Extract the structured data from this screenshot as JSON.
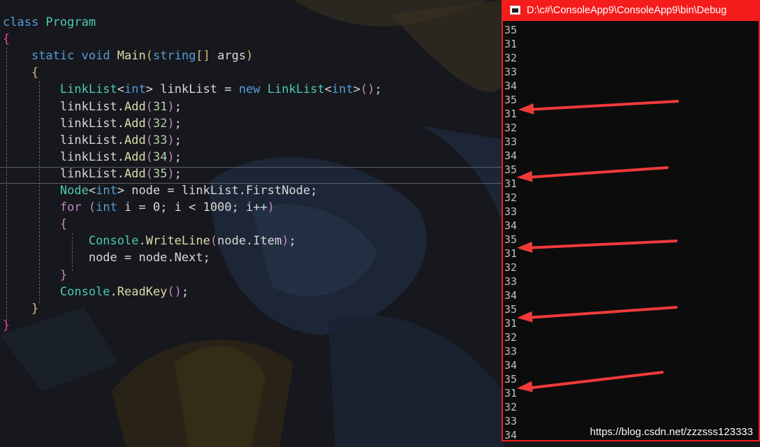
{
  "editor": {
    "lines": [
      [
        {
          "t": "class ",
          "c": "#569cd6"
        },
        {
          "t": "Program",
          "c": "#4ec9b0"
        }
      ],
      [
        {
          "t": "{",
          "c": "#e8489a"
        }
      ],
      [
        {
          "t": "    "
        },
        {
          "t": "static ",
          "c": "#569cd6"
        },
        {
          "t": "void ",
          "c": "#569cd6"
        },
        {
          "t": "Main",
          "c": "#dcdcaa"
        },
        {
          "t": "(",
          "c": "#d7ba7d"
        },
        {
          "t": "string",
          "c": "#569cd6"
        },
        {
          "t": "[]",
          "c": "#d7ba7d"
        },
        {
          "t": " args",
          "c": "#d8d8d8"
        },
        {
          "t": ")",
          "c": "#d7ba7d"
        }
      ],
      [
        {
          "t": "    "
        },
        {
          "t": "{",
          "c": "#d7ba7d"
        }
      ],
      [
        {
          "t": "        "
        },
        {
          "t": "LinkList",
          "c": "#4ec9b0"
        },
        {
          "t": "<",
          "c": "#d8d8d8"
        },
        {
          "t": "int",
          "c": "#569cd6"
        },
        {
          "t": "> linkList = ",
          "c": "#d8d8d8"
        },
        {
          "t": "new ",
          "c": "#569cd6"
        },
        {
          "t": "LinkList",
          "c": "#4ec9b0"
        },
        {
          "t": "<",
          "c": "#d8d8d8"
        },
        {
          "t": "int",
          "c": "#569cd6"
        },
        {
          "t": ">",
          "c": "#d8d8d8"
        },
        {
          "t": "()",
          "c": "#c586c0"
        },
        {
          "t": ";",
          "c": "#d8d8d8"
        }
      ],
      [
        {
          "t": "        "
        },
        {
          "t": "linkList.",
          "c": "#d8d8d8"
        },
        {
          "t": "Add",
          "c": "#dcdcaa"
        },
        {
          "t": "(",
          "c": "#c586c0"
        },
        {
          "t": "31",
          "c": "#b5cea8"
        },
        {
          "t": ")",
          "c": "#c586c0"
        },
        {
          "t": ";",
          "c": "#d8d8d8"
        }
      ],
      [
        {
          "t": "        "
        },
        {
          "t": "linkList.",
          "c": "#d8d8d8"
        },
        {
          "t": "Add",
          "c": "#dcdcaa"
        },
        {
          "t": "(",
          "c": "#c586c0"
        },
        {
          "t": "32",
          "c": "#b5cea8"
        },
        {
          "t": ")",
          "c": "#c586c0"
        },
        {
          "t": ";",
          "c": "#d8d8d8"
        }
      ],
      [
        {
          "t": "        "
        },
        {
          "t": "linkList.",
          "c": "#d8d8d8"
        },
        {
          "t": "Add",
          "c": "#dcdcaa"
        },
        {
          "t": "(",
          "c": "#c586c0"
        },
        {
          "t": "33",
          "c": "#b5cea8"
        },
        {
          "t": ")",
          "c": "#c586c0"
        },
        {
          "t": ";",
          "c": "#d8d8d8"
        }
      ],
      [
        {
          "t": "        "
        },
        {
          "t": "linkList.",
          "c": "#d8d8d8"
        },
        {
          "t": "Add",
          "c": "#dcdcaa"
        },
        {
          "t": "(",
          "c": "#c586c0"
        },
        {
          "t": "34",
          "c": "#b5cea8"
        },
        {
          "t": ")",
          "c": "#c586c0"
        },
        {
          "t": ";",
          "c": "#d8d8d8"
        }
      ],
      [
        {
          "t": "        "
        },
        {
          "t": "linkList.",
          "c": "#d8d8d8"
        },
        {
          "t": "Add",
          "c": "#dcdcaa"
        },
        {
          "t": "(",
          "c": "#c586c0"
        },
        {
          "t": "35",
          "c": "#b5cea8"
        },
        {
          "t": ")",
          "c": "#c586c0"
        },
        {
          "t": ";",
          "c": "#d8d8d8"
        }
      ],
      [
        {
          "t": "        "
        },
        {
          "t": "Node",
          "c": "#4ec9b0"
        },
        {
          "t": "<",
          "c": "#d8d8d8"
        },
        {
          "t": "int",
          "c": "#569cd6"
        },
        {
          "t": "> node = linkList.FirstNode;",
          "c": "#d8d8d8"
        }
      ],
      [
        {
          "t": "        "
        },
        {
          "t": "for ",
          "c": "#c586c0"
        },
        {
          "t": "(",
          "c": "#c586c0"
        },
        {
          "t": "int ",
          "c": "#569cd6"
        },
        {
          "t": "i = 0; i < 1000; i++",
          "c": "#d8d8d8"
        },
        {
          "t": ")",
          "c": "#c586c0"
        }
      ],
      [
        {
          "t": "        "
        },
        {
          "t": "{",
          "c": "#c586c0"
        }
      ],
      [
        {
          "t": "            "
        },
        {
          "t": "Console",
          "c": "#4ec9b0"
        },
        {
          "t": ".",
          "c": "#d8d8d8"
        },
        {
          "t": "WriteLine",
          "c": "#dcdcaa"
        },
        {
          "t": "(",
          "c": "#c586c0"
        },
        {
          "t": "node.Item",
          "c": "#d8d8d8"
        },
        {
          "t": ")",
          "c": "#c586c0"
        },
        {
          "t": ";",
          "c": "#d8d8d8"
        }
      ],
      [
        {
          "t": "            "
        },
        {
          "t": "node = node.Next;",
          "c": "#d8d8d8"
        }
      ],
      [
        {
          "t": "        "
        },
        {
          "t": "}",
          "c": "#c586c0"
        }
      ],
      [
        {
          "t": "        "
        },
        {
          "t": "Console",
          "c": "#4ec9b0"
        },
        {
          "t": ".",
          "c": "#d8d8d8"
        },
        {
          "t": "ReadKey",
          "c": "#dcdcaa"
        },
        {
          "t": "()",
          "c": "#c586c0"
        },
        {
          "t": ";",
          "c": "#d8d8d8"
        }
      ],
      [
        {
          "t": "    "
        },
        {
          "t": "}",
          "c": "#d7ba7d"
        }
      ],
      [
        {
          "t": "}",
          "c": "#e8489a"
        }
      ]
    ]
  },
  "console": {
    "title": "D:\\c#\\ConsoleApp9\\ConsoleApp9\\bin\\Debug",
    "output": [
      "35",
      "31",
      "32",
      "33",
      "34",
      "35",
      "31",
      "32",
      "33",
      "34",
      "35",
      "31",
      "32",
      "33",
      "34",
      "35",
      "31",
      "32",
      "33",
      "34",
      "35",
      "31",
      "32",
      "33",
      "34",
      "35",
      "31",
      "32",
      "33",
      "34"
    ],
    "arrow_color": "#f03a3a"
  },
  "watermark": "https://blog.csdn.net/zzzsss123333"
}
